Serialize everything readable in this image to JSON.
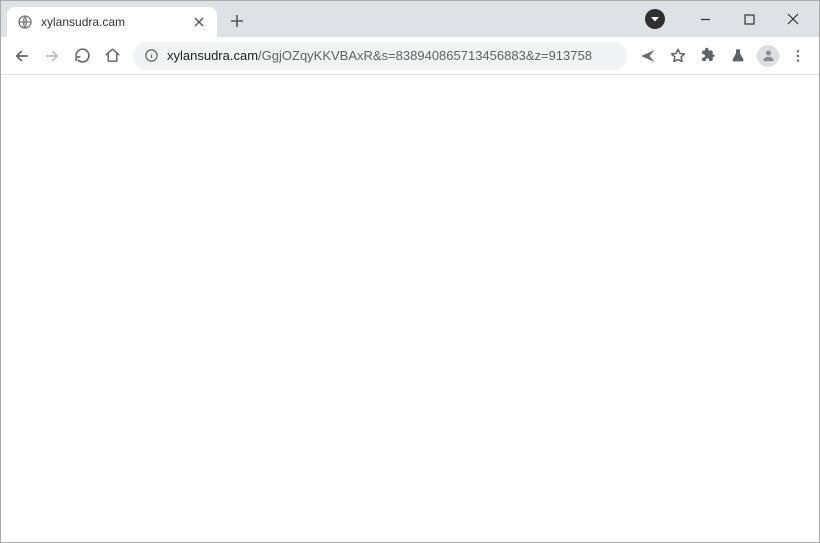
{
  "tab": {
    "title": "xylansudra.cam"
  },
  "url": {
    "domain": "xylansudra.cam",
    "path": "/GgjOZqyKKVBAxR&s=838940865713456883&z=913758"
  }
}
